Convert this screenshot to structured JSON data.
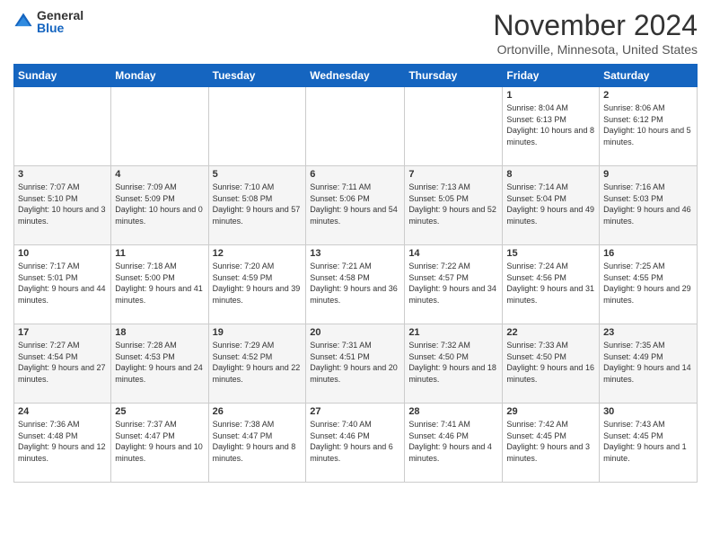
{
  "logo": {
    "general": "General",
    "blue": "Blue"
  },
  "title": "November 2024",
  "location": "Ortonville, Minnesota, United States",
  "headers": [
    "Sunday",
    "Monday",
    "Tuesday",
    "Wednesday",
    "Thursday",
    "Friday",
    "Saturday"
  ],
  "rows": [
    [
      {
        "day": "",
        "info": ""
      },
      {
        "day": "",
        "info": ""
      },
      {
        "day": "",
        "info": ""
      },
      {
        "day": "",
        "info": ""
      },
      {
        "day": "",
        "info": ""
      },
      {
        "day": "1",
        "info": "Sunrise: 8:04 AM\nSunset: 6:13 PM\nDaylight: 10 hours and 8 minutes."
      },
      {
        "day": "2",
        "info": "Sunrise: 8:06 AM\nSunset: 6:12 PM\nDaylight: 10 hours and 5 minutes."
      }
    ],
    [
      {
        "day": "3",
        "info": "Sunrise: 7:07 AM\nSunset: 5:10 PM\nDaylight: 10 hours and 3 minutes."
      },
      {
        "day": "4",
        "info": "Sunrise: 7:09 AM\nSunset: 5:09 PM\nDaylight: 10 hours and 0 minutes."
      },
      {
        "day": "5",
        "info": "Sunrise: 7:10 AM\nSunset: 5:08 PM\nDaylight: 9 hours and 57 minutes."
      },
      {
        "day": "6",
        "info": "Sunrise: 7:11 AM\nSunset: 5:06 PM\nDaylight: 9 hours and 54 minutes."
      },
      {
        "day": "7",
        "info": "Sunrise: 7:13 AM\nSunset: 5:05 PM\nDaylight: 9 hours and 52 minutes."
      },
      {
        "day": "8",
        "info": "Sunrise: 7:14 AM\nSunset: 5:04 PM\nDaylight: 9 hours and 49 minutes."
      },
      {
        "day": "9",
        "info": "Sunrise: 7:16 AM\nSunset: 5:03 PM\nDaylight: 9 hours and 46 minutes."
      }
    ],
    [
      {
        "day": "10",
        "info": "Sunrise: 7:17 AM\nSunset: 5:01 PM\nDaylight: 9 hours and 44 minutes."
      },
      {
        "day": "11",
        "info": "Sunrise: 7:18 AM\nSunset: 5:00 PM\nDaylight: 9 hours and 41 minutes."
      },
      {
        "day": "12",
        "info": "Sunrise: 7:20 AM\nSunset: 4:59 PM\nDaylight: 9 hours and 39 minutes."
      },
      {
        "day": "13",
        "info": "Sunrise: 7:21 AM\nSunset: 4:58 PM\nDaylight: 9 hours and 36 minutes."
      },
      {
        "day": "14",
        "info": "Sunrise: 7:22 AM\nSunset: 4:57 PM\nDaylight: 9 hours and 34 minutes."
      },
      {
        "day": "15",
        "info": "Sunrise: 7:24 AM\nSunset: 4:56 PM\nDaylight: 9 hours and 31 minutes."
      },
      {
        "day": "16",
        "info": "Sunrise: 7:25 AM\nSunset: 4:55 PM\nDaylight: 9 hours and 29 minutes."
      }
    ],
    [
      {
        "day": "17",
        "info": "Sunrise: 7:27 AM\nSunset: 4:54 PM\nDaylight: 9 hours and 27 minutes."
      },
      {
        "day": "18",
        "info": "Sunrise: 7:28 AM\nSunset: 4:53 PM\nDaylight: 9 hours and 24 minutes."
      },
      {
        "day": "19",
        "info": "Sunrise: 7:29 AM\nSunset: 4:52 PM\nDaylight: 9 hours and 22 minutes."
      },
      {
        "day": "20",
        "info": "Sunrise: 7:31 AM\nSunset: 4:51 PM\nDaylight: 9 hours and 20 minutes."
      },
      {
        "day": "21",
        "info": "Sunrise: 7:32 AM\nSunset: 4:50 PM\nDaylight: 9 hours and 18 minutes."
      },
      {
        "day": "22",
        "info": "Sunrise: 7:33 AM\nSunset: 4:50 PM\nDaylight: 9 hours and 16 minutes."
      },
      {
        "day": "23",
        "info": "Sunrise: 7:35 AM\nSunset: 4:49 PM\nDaylight: 9 hours and 14 minutes."
      }
    ],
    [
      {
        "day": "24",
        "info": "Sunrise: 7:36 AM\nSunset: 4:48 PM\nDaylight: 9 hours and 12 minutes."
      },
      {
        "day": "25",
        "info": "Sunrise: 7:37 AM\nSunset: 4:47 PM\nDaylight: 9 hours and 10 minutes."
      },
      {
        "day": "26",
        "info": "Sunrise: 7:38 AM\nSunset: 4:47 PM\nDaylight: 9 hours and 8 minutes."
      },
      {
        "day": "27",
        "info": "Sunrise: 7:40 AM\nSunset: 4:46 PM\nDaylight: 9 hours and 6 minutes."
      },
      {
        "day": "28",
        "info": "Sunrise: 7:41 AM\nSunset: 4:46 PM\nDaylight: 9 hours and 4 minutes."
      },
      {
        "day": "29",
        "info": "Sunrise: 7:42 AM\nSunset: 4:45 PM\nDaylight: 9 hours and 3 minutes."
      },
      {
        "day": "30",
        "info": "Sunrise: 7:43 AM\nSunset: 4:45 PM\nDaylight: 9 hours and 1 minute."
      }
    ]
  ]
}
